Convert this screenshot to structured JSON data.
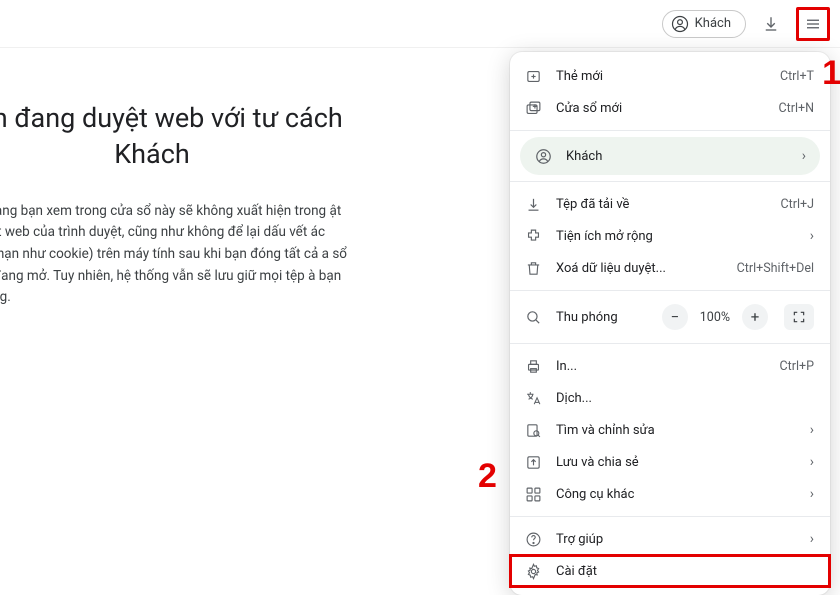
{
  "toolbar": {
    "profile_label": "Khách"
  },
  "page": {
    "title_line1": "Bạn đang duyệt web với tư cách",
    "title_line2": "Khách",
    "body": "hững trang bạn xem trong cửa sổ này sẽ không xuất hiện trong ật ký duyệt web của trình duyệt, cũng như không để lại dấu vết ác (chẳng hạn như cookie) trên máy tính sau khi bạn đóng tất cả a sổ Khách đang mở. Tuy nhiên, hệ thống vẫn sẽ lưu giữ mọi tệp à bạn tải xuống."
  },
  "menu": {
    "new_tab": {
      "label": "Thẻ mới",
      "shortcut": "Ctrl+T"
    },
    "new_window": {
      "label": "Cửa sổ mới",
      "shortcut": "Ctrl+N"
    },
    "guest": {
      "label": "Khách"
    },
    "downloads": {
      "label": "Tệp đã tải về",
      "shortcut": "Ctrl+J"
    },
    "extensions": {
      "label": "Tiện ích mở rộng"
    },
    "clear_data": {
      "label": "Xoá dữ liệu duyệt...",
      "shortcut": "Ctrl+Shift+Del"
    },
    "zoom": {
      "label": "Thu phóng",
      "value": "100%"
    },
    "print": {
      "label": "In...",
      "shortcut": "Ctrl+P"
    },
    "translate": {
      "label": "Dịch..."
    },
    "find_edit": {
      "label": "Tìm và chỉnh sửa"
    },
    "save_share": {
      "label": "Lưu và chia sẻ"
    },
    "more_tools": {
      "label": "Công cụ khác"
    },
    "help": {
      "label": "Trợ giúp"
    },
    "settings": {
      "label": "Cài đặt"
    }
  },
  "annotations": {
    "one": "1",
    "two": "2"
  }
}
